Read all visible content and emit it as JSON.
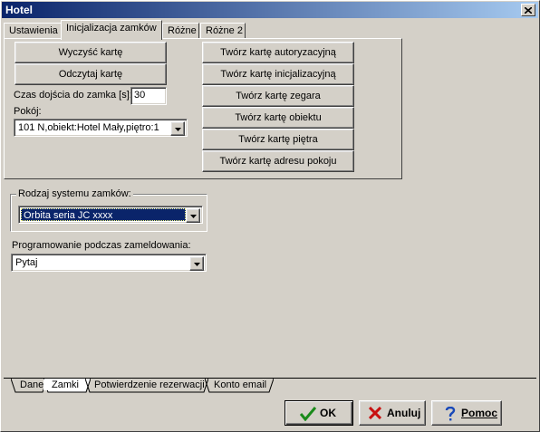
{
  "window": {
    "title": "Hotel",
    "close_label": "x"
  },
  "tabs": [
    {
      "label": "Ustawienia"
    },
    {
      "label": "Inicjalizacja zamków"
    },
    {
      "label": "Różne"
    },
    {
      "label": "Różne 2"
    }
  ],
  "init_tab": {
    "clear_card": "Wyczyść kartę",
    "read_card": "Odczytaj kartę",
    "access_time_label": "Czas dojścia do zamka [s]:",
    "access_time_value": "30",
    "rooms_label": "Pokój:",
    "room_selected": "101 N,obiekt:Hotel Mały,piętro:1",
    "card_buttons": [
      "Twórz kartę autoryzacyjną",
      "Twórz kartę inicjalizacyjną",
      "Twórz kartę zegara",
      "Twórz kartę obiektu",
      "Twórz kartę piętra",
      "Twórz kartę adresu pokoju"
    ]
  },
  "lock_system": {
    "group_label": "Rodzaj systemu zamków:",
    "selected": "Orbita seria JC xxxx"
  },
  "checkin_programming": {
    "label": "Programowanie podczas zameldowania:",
    "selected": "Pytaj"
  },
  "bottom_tabs": [
    {
      "label": "Dane"
    },
    {
      "label": "Zamki"
    },
    {
      "label": "Potwierdzenie rezerwacji"
    },
    {
      "label": "Konto email"
    }
  ],
  "buttons": {
    "ok": "OK",
    "cancel": "Anuluj",
    "help": "Pomoc"
  },
  "colors": {
    "titlebar_start": "#0a246a",
    "titlebar_end": "#a6caf0",
    "face": "#d4d0c8",
    "selection": "#0a246a"
  }
}
